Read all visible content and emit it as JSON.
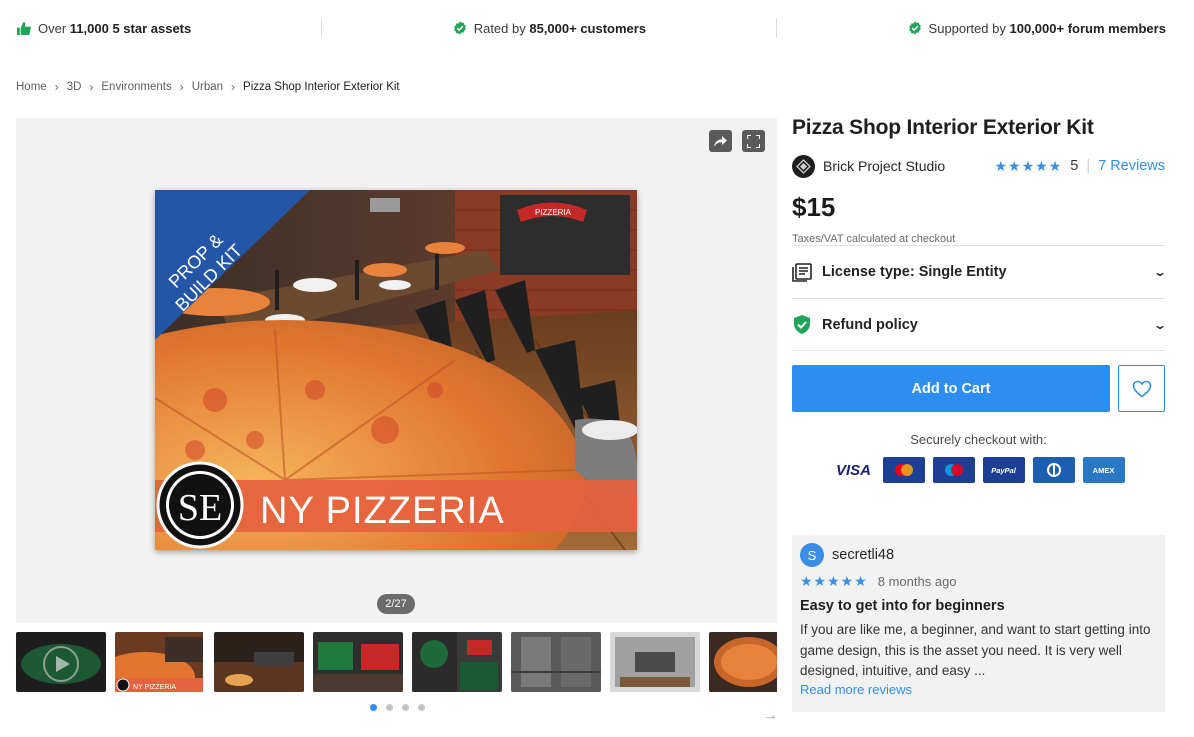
{
  "colors": {
    "accent": "#2d8ef0",
    "check_green": "#22a55a",
    "star": "#3a8ee6"
  },
  "trust": [
    {
      "icon": "thumbs-up-icon",
      "prefix": "Over ",
      "bold": "11,000 5 star assets",
      "suffix": ""
    },
    {
      "icon": "check-badge-icon",
      "prefix": "Rated by ",
      "bold": "85,000+ customers",
      "suffix": ""
    },
    {
      "icon": "check-badge-icon",
      "prefix": "Supported by ",
      "bold": "100,000+ forum members",
      "suffix": ""
    }
  ],
  "breadcrumb": {
    "items": [
      "Home",
      "3D",
      "Environments",
      "Urban"
    ],
    "current": "Pizza Shop Interior Exterior Kit",
    "separator": ">"
  },
  "gallery": {
    "counter": "2/27",
    "hero_banner_text": "NY PIZZERIA",
    "hero_corner_text": [
      "PROP &",
      "BUILD KIT"
    ],
    "hero_logo_text": "SE",
    "hero_sign_text": "PIZZERIA",
    "thumb_banner_text": "NY PIZZERIA",
    "next_arrow": "→"
  },
  "product": {
    "title": "Pizza Shop Interior Exterior Kit",
    "seller": "Brick Project Studio",
    "stars": "★★★★★",
    "rating": "5",
    "reviews_link": "7 Reviews",
    "price": "$15",
    "tax_note": "Taxes/VAT calculated at checkout",
    "license_label": "License type: Single Entity",
    "refund_label": "Refund policy",
    "chevron": "⌄",
    "add_to_cart": "Add to Cart",
    "secure_text": "Securely checkout with:",
    "payments": {
      "visa": "VISA",
      "paypal": "PayPal",
      "amex": "AMEX"
    }
  },
  "review": {
    "avatar_letter": "S",
    "user": "secretli48",
    "stars": "★★★★★",
    "time": "8 months ago",
    "title": "Easy to get into for beginners",
    "body": "If you are like me, a beginner, and want to start getting into game design, this is the asset you need. It is very well designed, intuitive, and easy ...",
    "read_more": "Read more reviews"
  }
}
